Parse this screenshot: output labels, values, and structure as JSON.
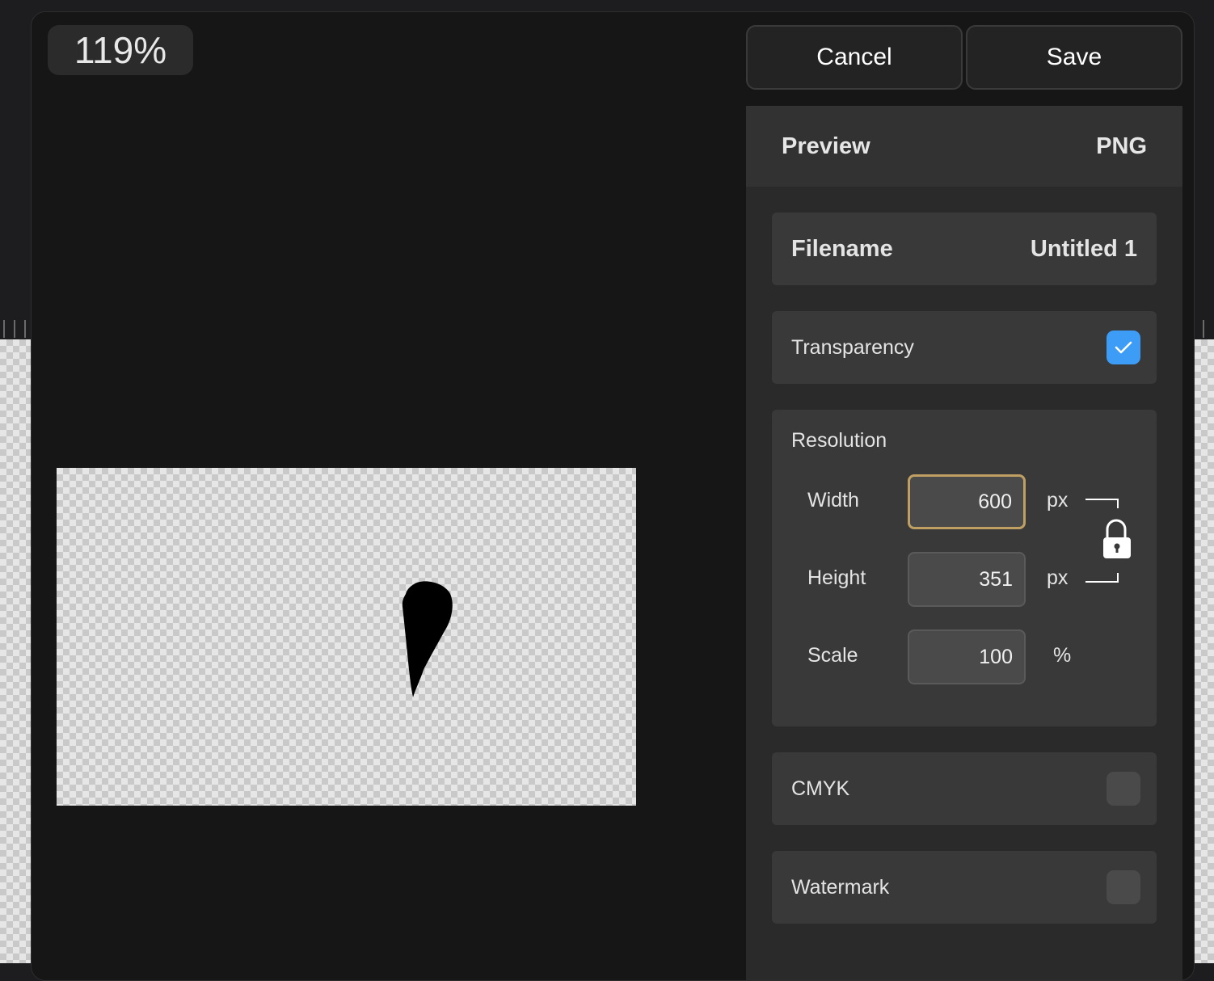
{
  "zoom": {
    "level": "119%"
  },
  "toolbar": {
    "cancel_label": "Cancel",
    "save_label": "Save"
  },
  "panel": {
    "title": "Preview",
    "format": "PNG",
    "filename": {
      "label": "Filename",
      "value": "Untitled 1"
    },
    "transparency": {
      "label": "Transparency",
      "checked": true
    },
    "resolution": {
      "title": "Resolution",
      "width": {
        "label": "Width",
        "value": "600",
        "unit": "px"
      },
      "height": {
        "label": "Height",
        "value": "351",
        "unit": "px"
      },
      "scale": {
        "label": "Scale",
        "value": "100",
        "unit": "%"
      },
      "aspect_lock": "unlocked"
    },
    "cmyk": {
      "label": "CMYK",
      "checked": false
    },
    "watermark": {
      "label": "Watermark",
      "checked": false
    }
  },
  "colors": {
    "accent": "#3d9cf5",
    "focus_border": "#c0a062",
    "dialog_bg": "#161616",
    "panel_bg": "#2a2a2a",
    "row_bg": "#393939"
  },
  "icons": {
    "transparency_check": "checkmark-icon",
    "aspect_lock": "lock-open-icon"
  }
}
